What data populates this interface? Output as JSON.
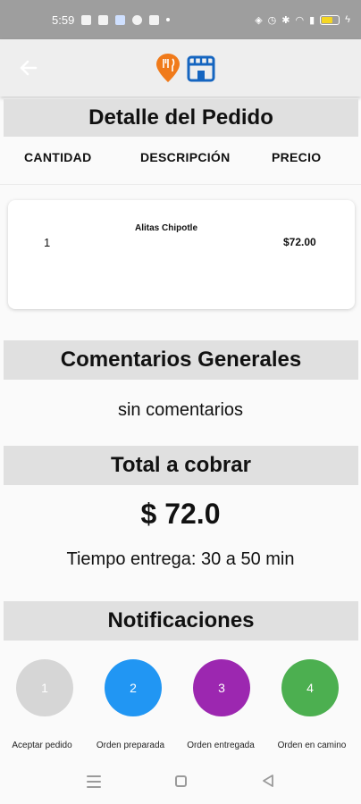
{
  "status_bar": {
    "time": "5:59"
  },
  "order_detail": {
    "title": "Detalle del Pedido",
    "col_quantity": "CANTIDAD",
    "col_description": "DESCRIPCIÓN",
    "col_price": "PRECIO",
    "items": [
      {
        "quantity": "1",
        "description": "Alitas Chipotle",
        "price": "$72.00"
      }
    ]
  },
  "comments": {
    "title": "Comentarios Generales",
    "text": "sin comentarios"
  },
  "total": {
    "title": "Total a cobrar",
    "amount": "$ 72.0",
    "delivery_time": "Tiempo entrega: 30 a 50 min"
  },
  "notifications": {
    "title": "Notificaciones",
    "steps": [
      {
        "number": "1",
        "label": "Aceptar pedido",
        "color": "#d6d6d6"
      },
      {
        "number": "2",
        "label": "Orden preparada",
        "color": "#2196f3"
      },
      {
        "number": "3",
        "label": "Orden entregada",
        "color": "#9c27b0"
      },
      {
        "number": "4",
        "label": "Orden en camino",
        "color": "#4caf50"
      }
    ]
  },
  "colors": {
    "accent_orange": "#f07a1a",
    "accent_blue": "#1565c0"
  }
}
